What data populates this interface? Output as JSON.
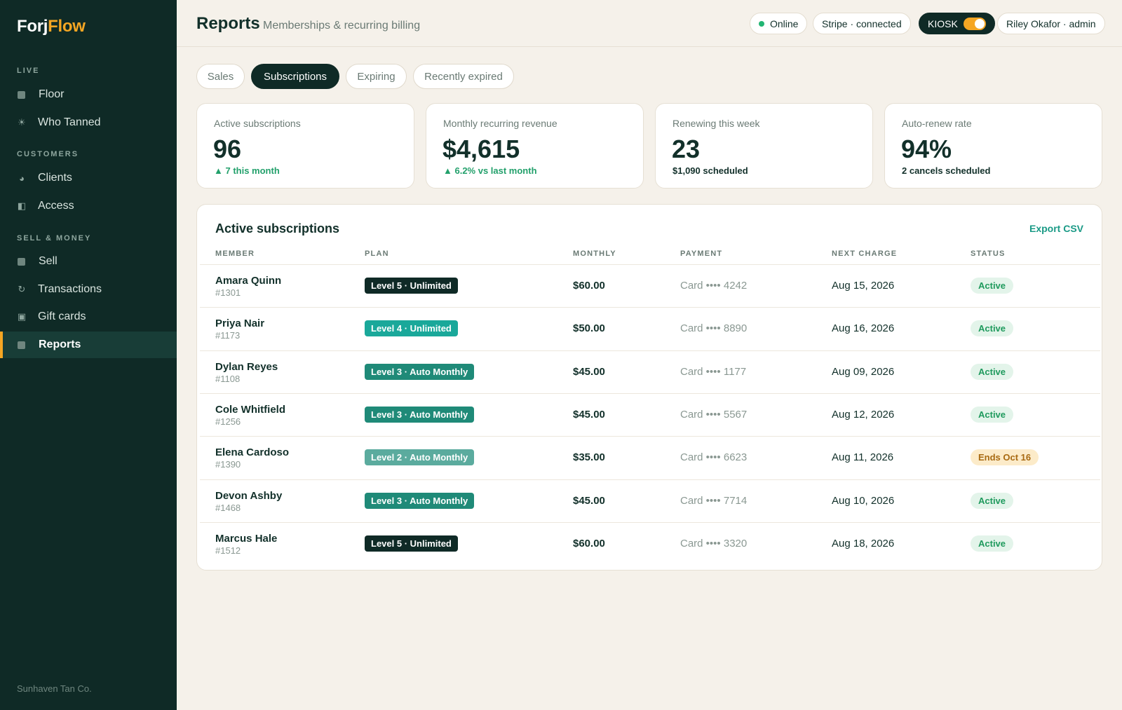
{
  "app": {
    "logo_main": "Forj",
    "logo_accent": "Flow",
    "footer": "Sunhaven Tan Co."
  },
  "sidebar": {
    "sections": [
      {
        "label": "LIVE"
      },
      {
        "label": "CUSTOMERS"
      },
      {
        "label": "SELL & MONEY"
      }
    ],
    "items": [
      {
        "label": "Floor",
        "icon": "floor-icon"
      },
      {
        "label": "Who Tanned",
        "icon": "sun-icon"
      },
      {
        "label": "Clients",
        "icon": "clients-icon"
      },
      {
        "label": "Access",
        "icon": "access-icon"
      },
      {
        "label": "Sell",
        "icon": "sell-icon"
      },
      {
        "label": "Transactions",
        "icon": "refresh-icon"
      },
      {
        "label": "Gift cards",
        "icon": "gift-card-icon"
      },
      {
        "label": "Reports",
        "icon": "reports-icon",
        "active": true
      }
    ]
  },
  "header": {
    "title": "Reports",
    "subtitle": "Memberships & recurring billing",
    "status": "Online",
    "stripe": "Stripe · connected",
    "kiosk": "KIOSK",
    "kiosk_on": true,
    "user": "Riley Okafor · admin"
  },
  "tabs": [
    {
      "label": "Sales"
    },
    {
      "label": "Subscriptions",
      "active": true
    },
    {
      "label": "Expiring"
    },
    {
      "label": "Recently expired"
    }
  ],
  "stats": [
    {
      "label": "Active subscriptions",
      "value": "96",
      "sub": "▲ 7 this month"
    },
    {
      "label": "Monthly recurring revenue",
      "value": "$4,615",
      "sub": "▲ 6.2% vs last month"
    },
    {
      "label": "Renewing this week",
      "value": "23",
      "sub": "$1,090 scheduled"
    },
    {
      "label": "Auto-renew rate",
      "value": "94%",
      "sub": "2 cancels scheduled"
    }
  ],
  "table": {
    "title": "Active subscriptions",
    "export_label": "Export CSV",
    "columns": [
      "MEMBER",
      "PLAN",
      "MONTHLY",
      "PAYMENT",
      "NEXT CHARGE",
      "STATUS"
    ],
    "rows": [
      {
        "name": "Amara Quinn",
        "id": "#1301",
        "plan": "Level 5 · Unlimited",
        "monthly": "$60.00",
        "payment": "Card •••• 4242",
        "next": "Aug 15, 2026",
        "status": "Active"
      },
      {
        "name": "Priya Nair",
        "id": "#1173",
        "plan": "Level 4 · Unlimited",
        "monthly": "$50.00",
        "payment": "Card •••• 8890",
        "next": "Aug 16, 2026",
        "status": "Active"
      },
      {
        "name": "Dylan Reyes",
        "id": "#1108",
        "plan": "Level 3 · Auto Monthly",
        "monthly": "$45.00",
        "payment": "Card •••• 1177",
        "next": "Aug 09, 2026",
        "status": "Active"
      },
      {
        "name": "Cole Whitfield",
        "id": "#1256",
        "plan": "Level 3 · Auto Monthly",
        "monthly": "$45.00",
        "payment": "Card •••• 5567",
        "next": "Aug 12, 2026",
        "status": "Active"
      },
      {
        "name": "Elena Cardoso",
        "id": "#1390",
        "plan": "Level 2 · Auto Monthly",
        "monthly": "$35.00",
        "payment": "Card •••• 6623",
        "next": "Aug 11, 2026",
        "status": "Ends Oct 16"
      },
      {
        "name": "Devon Ashby",
        "id": "#1468",
        "plan": "Level 3 · Auto Monthly",
        "monthly": "$45.00",
        "payment": "Card •••• 7714",
        "next": "Aug 10, 2026",
        "status": "Active"
      },
      {
        "name": "Marcus Hale",
        "id": "#1512",
        "plan": "Level 5 · Unlimited",
        "monthly": "$60.00",
        "payment": "Card •••• 3320",
        "next": "Aug 18, 2026",
        "status": "Active"
      }
    ]
  },
  "colors": {
    "sidebar_bg": "#0f2a26",
    "accent": "#f5a623",
    "teal": "#1a9a86",
    "level5": "#0f2a26",
    "level4": "#1aa89a",
    "level3": "#1f8a78",
    "level2": "#5bab9e",
    "active_green": "#1f9a5d",
    "warn": "#a86a12"
  }
}
